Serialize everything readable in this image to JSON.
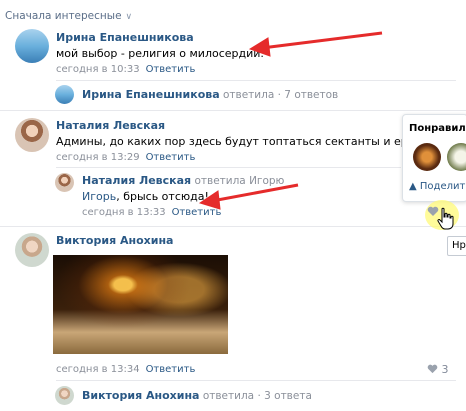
{
  "sort_label": "Сначала интересные",
  "comments": [
    {
      "author": "Ирина Епанешникова",
      "text": "мой выбор - религия о милосердии.",
      "time": "сегодня в 10:33",
      "reply": "Ответить",
      "thread": {
        "author": "Ирина Епанешникова",
        "verb": "ответила",
        "sep": "·",
        "count": "7 ответов"
      }
    },
    {
      "author": "Наталия Левская",
      "text": "Админы, до каких пор здесь будут топтаться сектанты и еретики?",
      "time": "сегодня в 13:29",
      "reply": "Ответить",
      "nested": {
        "author": "Наталия Левская",
        "verb": "ответила Игорю",
        "text_addressee": "Игорь",
        "text_rest": ", брысь отсюда!",
        "time": "сегодня в 13:33",
        "reply": "Ответить"
      }
    },
    {
      "author": "Виктория Анохина",
      "time": "сегодня в 13:34",
      "reply": "Ответить",
      "likes": "3",
      "thread": {
        "author": "Виктория Анохина",
        "verb": "ответила",
        "sep": "·",
        "count": "3 ответа"
      }
    }
  ],
  "popup": {
    "title": "Понравилось",
    "share": "Поделит"
  },
  "tooltip": "Нр",
  "annotation_color": "#e52b2b"
}
